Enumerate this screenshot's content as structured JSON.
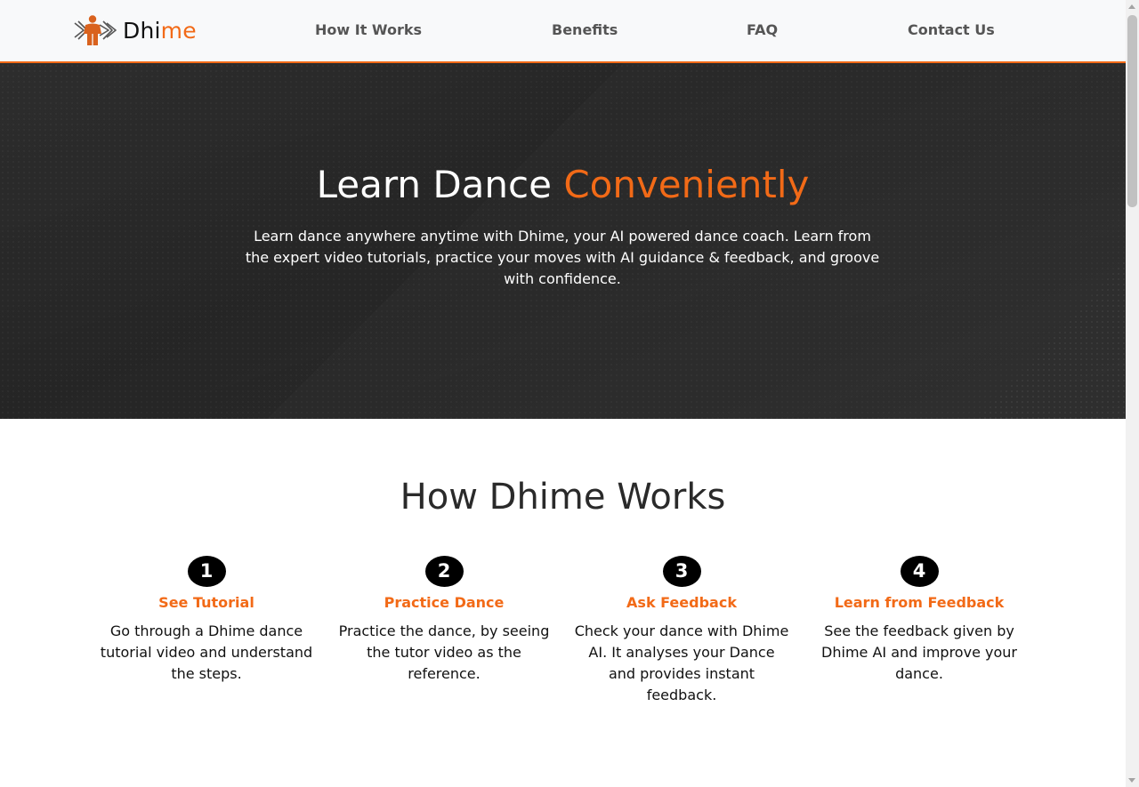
{
  "nav": {
    "brand": {
      "part1": "Dhi",
      "part2": "me"
    },
    "links": [
      "How It Works",
      "Benefits",
      "FAQ",
      "Contact Us"
    ]
  },
  "hero": {
    "title_plain": "Learn Dance ",
    "title_accent": "Conveniently",
    "text": "Learn dance anywhere anytime with Dhime, your AI powered dance coach. Learn from the expert video tutorials, practice your moves with AI guidance & feedback, and groove with confidence."
  },
  "how": {
    "title": "How Dhime Works",
    "steps": [
      {
        "num": "1",
        "title": "See Tutorial",
        "desc": "Go through a Dhime dance tutorial video and understand the steps."
      },
      {
        "num": "2",
        "title": "Practice Dance",
        "desc": "Practice the dance, by seeing the tutor video as the reference."
      },
      {
        "num": "3",
        "title": "Ask Feedback",
        "desc": "Check your dance with Dhime AI. It analyses your Dance and provides instant feedback."
      },
      {
        "num": "4",
        "title": "Learn from Feedback",
        "desc": "See the feedback given by Dhime AI and improve your dance."
      }
    ]
  },
  "theme": {
    "accent": "#f26a17",
    "dark": "#2f2f2f",
    "nav_bg": "#f8f9fa"
  },
  "icons": {
    "logo": "dancer-logo-icon"
  }
}
